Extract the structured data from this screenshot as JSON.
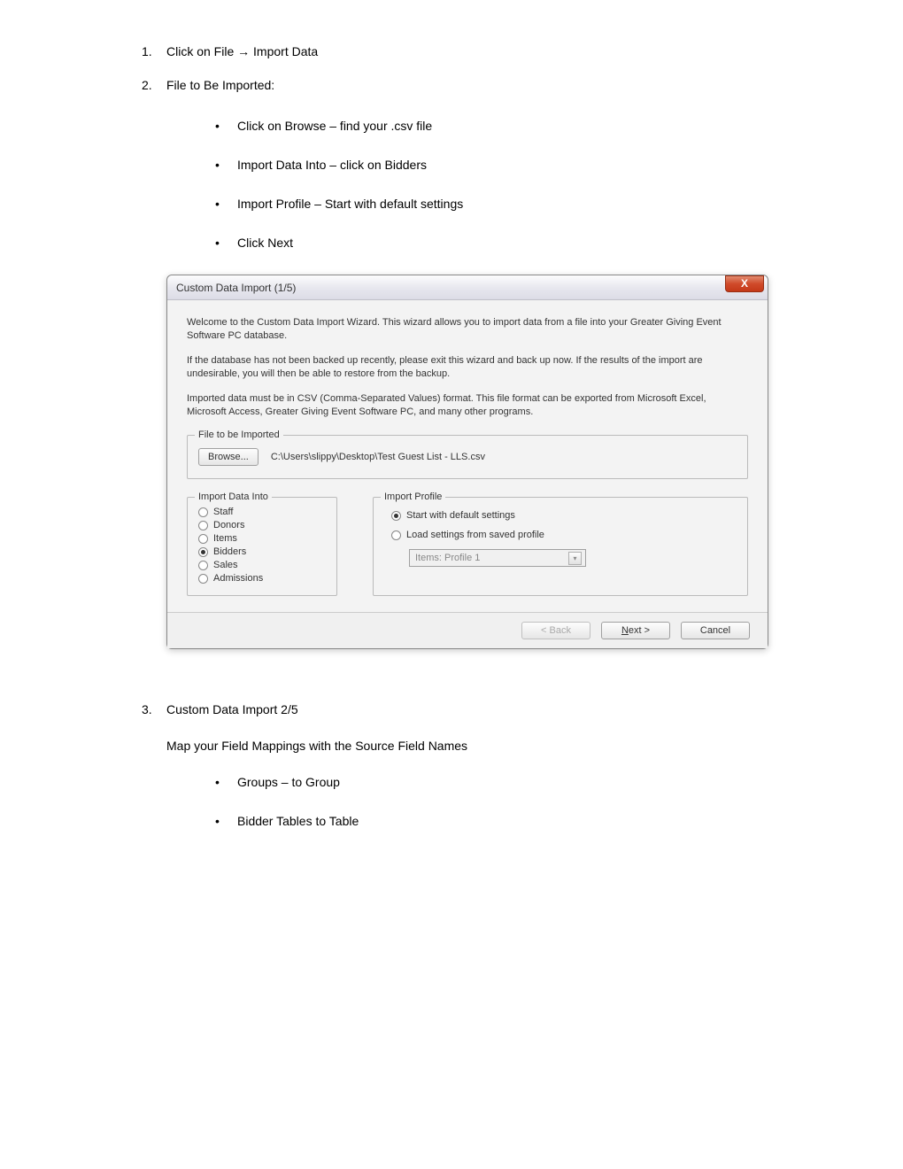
{
  "steps": {
    "s1": {
      "num": "1.",
      "title_prefix": "Click on File ",
      "arrow": "→",
      "title_suffix": " Import Data"
    },
    "s2": {
      "num": "2.",
      "title": "File to Be Imported:",
      "bullets": {
        "b1": "Click on Browse – find your .csv file",
        "b2": "Import Data Into – click on Bidders",
        "b3": "Import Profile – Start with default settings",
        "b4": "Click Next"
      }
    },
    "s3": {
      "num": "3.",
      "title": "Custom Data Import 2/5",
      "intro": "Map your Field Mappings with the Source Field Names",
      "bullets": {
        "b1": "Groups – to Group",
        "b2": "Bidder Tables to Table"
      }
    }
  },
  "dialog": {
    "title": "Custom Data Import (1/5)",
    "close": "X",
    "para1": "Welcome to the Custom Data Import Wizard. This wizard allows you to import data from a file into your Greater Giving Event Software PC database.",
    "para2": "If the database has not been backed up recently, please exit this wizard and back up now. If the results of the import are undesirable, you will then be able to restore from the backup.",
    "para3": "Imported data must be in CSV (Comma-Separated Values) format. This file format can be exported from Microsoft Excel, Microsoft Access, Greater Giving Event Software PC, and many other programs.",
    "file_legend": "File to be Imported",
    "browse": "Browse...",
    "filepath": "C:\\Users\\slippy\\Desktop\\Test Guest List - LLS.csv",
    "into_legend": "Import Data Into",
    "into_options": {
      "staff": "Staff",
      "donors": "Donors",
      "items": "Items",
      "bidders": "Bidders",
      "sales": "Sales",
      "admissions": "Admissions"
    },
    "profile_legend": "Import Profile",
    "profile_default": "Start with default settings",
    "profile_load": "Load settings from saved profile",
    "profile_select": "Items: Profile 1",
    "btn_back": "< Back",
    "btn_next": "Next >",
    "btn_cancel": "Cancel"
  }
}
